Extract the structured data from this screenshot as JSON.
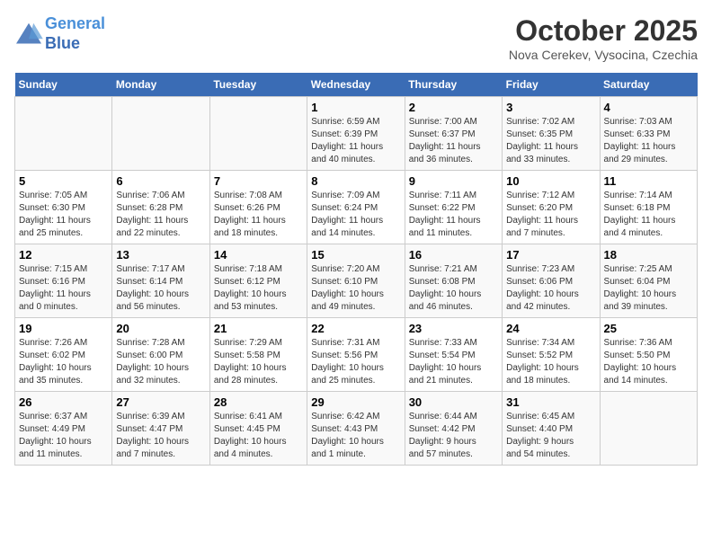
{
  "header": {
    "logo_line1": "General",
    "logo_line2": "Blue",
    "title": "October 2025",
    "location": "Nova Cerekev, Vysocina, Czechia"
  },
  "weekdays": [
    "Sunday",
    "Monday",
    "Tuesday",
    "Wednesday",
    "Thursday",
    "Friday",
    "Saturday"
  ],
  "weeks": [
    [
      {
        "day": "",
        "info": ""
      },
      {
        "day": "",
        "info": ""
      },
      {
        "day": "",
        "info": ""
      },
      {
        "day": "1",
        "info": "Sunrise: 6:59 AM\nSunset: 6:39 PM\nDaylight: 11 hours\nand 40 minutes."
      },
      {
        "day": "2",
        "info": "Sunrise: 7:00 AM\nSunset: 6:37 PM\nDaylight: 11 hours\nand 36 minutes."
      },
      {
        "day": "3",
        "info": "Sunrise: 7:02 AM\nSunset: 6:35 PM\nDaylight: 11 hours\nand 33 minutes."
      },
      {
        "day": "4",
        "info": "Sunrise: 7:03 AM\nSunset: 6:33 PM\nDaylight: 11 hours\nand 29 minutes."
      }
    ],
    [
      {
        "day": "5",
        "info": "Sunrise: 7:05 AM\nSunset: 6:30 PM\nDaylight: 11 hours\nand 25 minutes."
      },
      {
        "day": "6",
        "info": "Sunrise: 7:06 AM\nSunset: 6:28 PM\nDaylight: 11 hours\nand 22 minutes."
      },
      {
        "day": "7",
        "info": "Sunrise: 7:08 AM\nSunset: 6:26 PM\nDaylight: 11 hours\nand 18 minutes."
      },
      {
        "day": "8",
        "info": "Sunrise: 7:09 AM\nSunset: 6:24 PM\nDaylight: 11 hours\nand 14 minutes."
      },
      {
        "day": "9",
        "info": "Sunrise: 7:11 AM\nSunset: 6:22 PM\nDaylight: 11 hours\nand 11 minutes."
      },
      {
        "day": "10",
        "info": "Sunrise: 7:12 AM\nSunset: 6:20 PM\nDaylight: 11 hours\nand 7 minutes."
      },
      {
        "day": "11",
        "info": "Sunrise: 7:14 AM\nSunset: 6:18 PM\nDaylight: 11 hours\nand 4 minutes."
      }
    ],
    [
      {
        "day": "12",
        "info": "Sunrise: 7:15 AM\nSunset: 6:16 PM\nDaylight: 11 hours\nand 0 minutes."
      },
      {
        "day": "13",
        "info": "Sunrise: 7:17 AM\nSunset: 6:14 PM\nDaylight: 10 hours\nand 56 minutes."
      },
      {
        "day": "14",
        "info": "Sunrise: 7:18 AM\nSunset: 6:12 PM\nDaylight: 10 hours\nand 53 minutes."
      },
      {
        "day": "15",
        "info": "Sunrise: 7:20 AM\nSunset: 6:10 PM\nDaylight: 10 hours\nand 49 minutes."
      },
      {
        "day": "16",
        "info": "Sunrise: 7:21 AM\nSunset: 6:08 PM\nDaylight: 10 hours\nand 46 minutes."
      },
      {
        "day": "17",
        "info": "Sunrise: 7:23 AM\nSunset: 6:06 PM\nDaylight: 10 hours\nand 42 minutes."
      },
      {
        "day": "18",
        "info": "Sunrise: 7:25 AM\nSunset: 6:04 PM\nDaylight: 10 hours\nand 39 minutes."
      }
    ],
    [
      {
        "day": "19",
        "info": "Sunrise: 7:26 AM\nSunset: 6:02 PM\nDaylight: 10 hours\nand 35 minutes."
      },
      {
        "day": "20",
        "info": "Sunrise: 7:28 AM\nSunset: 6:00 PM\nDaylight: 10 hours\nand 32 minutes."
      },
      {
        "day": "21",
        "info": "Sunrise: 7:29 AM\nSunset: 5:58 PM\nDaylight: 10 hours\nand 28 minutes."
      },
      {
        "day": "22",
        "info": "Sunrise: 7:31 AM\nSunset: 5:56 PM\nDaylight: 10 hours\nand 25 minutes."
      },
      {
        "day": "23",
        "info": "Sunrise: 7:33 AM\nSunset: 5:54 PM\nDaylight: 10 hours\nand 21 minutes."
      },
      {
        "day": "24",
        "info": "Sunrise: 7:34 AM\nSunset: 5:52 PM\nDaylight: 10 hours\nand 18 minutes."
      },
      {
        "day": "25",
        "info": "Sunrise: 7:36 AM\nSunset: 5:50 PM\nDaylight: 10 hours\nand 14 minutes."
      }
    ],
    [
      {
        "day": "26",
        "info": "Sunrise: 6:37 AM\nSunset: 4:49 PM\nDaylight: 10 hours\nand 11 minutes."
      },
      {
        "day": "27",
        "info": "Sunrise: 6:39 AM\nSunset: 4:47 PM\nDaylight: 10 hours\nand 7 minutes."
      },
      {
        "day": "28",
        "info": "Sunrise: 6:41 AM\nSunset: 4:45 PM\nDaylight: 10 hours\nand 4 minutes."
      },
      {
        "day": "29",
        "info": "Sunrise: 6:42 AM\nSunset: 4:43 PM\nDaylight: 10 hours\nand 1 minute."
      },
      {
        "day": "30",
        "info": "Sunrise: 6:44 AM\nSunset: 4:42 PM\nDaylight: 9 hours\nand 57 minutes."
      },
      {
        "day": "31",
        "info": "Sunrise: 6:45 AM\nSunset: 4:40 PM\nDaylight: 9 hours\nand 54 minutes."
      },
      {
        "day": "",
        "info": ""
      }
    ]
  ]
}
